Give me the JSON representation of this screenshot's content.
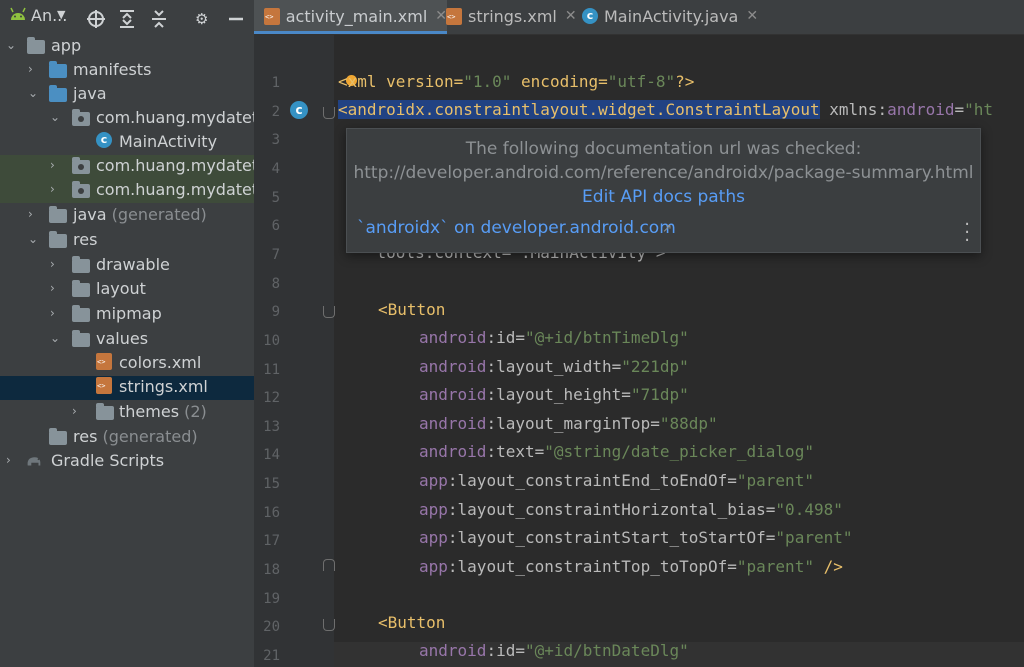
{
  "project": {
    "title": "An...",
    "items": [
      {
        "label": "app"
      },
      {
        "label": "manifests"
      },
      {
        "label": "java"
      },
      {
        "label": "com.huang.mydatetin"
      },
      {
        "label": "MainActivity"
      },
      {
        "label": "com.huang.mydatetin"
      },
      {
        "label": "com.huang.mydatetin"
      },
      {
        "label": "java",
        "suffix": "(generated)"
      },
      {
        "label": "res"
      },
      {
        "label": "drawable"
      },
      {
        "label": "layout"
      },
      {
        "label": "mipmap"
      },
      {
        "label": "values"
      },
      {
        "label": "colors.xml"
      },
      {
        "label": "strings.xml"
      },
      {
        "label": "themes",
        "suffix": "(2)"
      },
      {
        "label": "res",
        "suffix": "(generated)"
      },
      {
        "label": "Gradle Scripts"
      }
    ]
  },
  "tabs": [
    {
      "label": "activity_main.xml",
      "active": true
    },
    {
      "label": "strings.xml",
      "active": false
    },
    {
      "label": "MainActivity.java",
      "active": false
    }
  ],
  "editor": {
    "line_numbers": [
      "1",
      "2",
      "3",
      "4",
      "5",
      "6",
      "7",
      "8",
      "9",
      "10",
      "11",
      "12",
      "13",
      "14",
      "15",
      "16",
      "17",
      "18",
      "19",
      "20",
      "21"
    ],
    "line1": {
      "p1": "<",
      "p2": "xml version=",
      "p3": "\"1.0\"",
      "p4": " encoding=",
      "p5": "\"utf-8\"",
      "p6": "?>"
    },
    "line2": {
      "tag": "<androidx.constraintlayout.widget.ConstraintLayout",
      "attr": " xmlns:",
      "ns": "android",
      "eq": "=",
      "str": "\"ht"
    },
    "line7": {
      "text": "    tools:context=\".MainActivity\">"
    },
    "line9": {
      "tag": "<Button"
    },
    "attrs_block1": [
      {
        "ns": "android",
        "name": ":id=",
        "value": "\"@+id/btnTimeDlg\""
      },
      {
        "ns": "android",
        "name": ":layout_width=",
        "value": "\"221dp\""
      },
      {
        "ns": "android",
        "name": ":layout_height=",
        "value": "\"71dp\""
      },
      {
        "ns": "android",
        "name": ":layout_marginTop=",
        "value": "\"88dp\""
      },
      {
        "ns": "android",
        "name": ":text=",
        "value": "\"@string/date_picker_dialog\""
      },
      {
        "ns": "app",
        "name": ":layout_constraintEnd_toEndOf=",
        "value": "\"parent\""
      },
      {
        "ns": "app",
        "name": ":layout_constraintHorizontal_bias=",
        "value": "\"0.498\""
      },
      {
        "ns": "app",
        "name": ":layout_constraintStart_toStartOf=",
        "value": "\"parent\""
      },
      {
        "ns": "app",
        "name": ":layout_constraintTop_toTopOf=",
        "value": "\"parent\"",
        "close": " />"
      }
    ],
    "line20": {
      "tag": "<Button"
    },
    "line21": {
      "ns": "android",
      "name": ":id=",
      "value": "\"@+id/btnDateDlg\""
    }
  },
  "popup": {
    "line1": "The following documentation url was checked:",
    "line2": "http://developer.android.com/reference/androidx/package-summary.html",
    "link": "Edit API docs paths",
    "footer": "`androidx` on developer.android.com",
    "more_icon": "more-vertical-icon"
  },
  "colors": {
    "tag": "#e8bf6a",
    "namespace": "#9876aa",
    "string": "#6a8759",
    "selection": "#214283",
    "link": "#589df6"
  }
}
